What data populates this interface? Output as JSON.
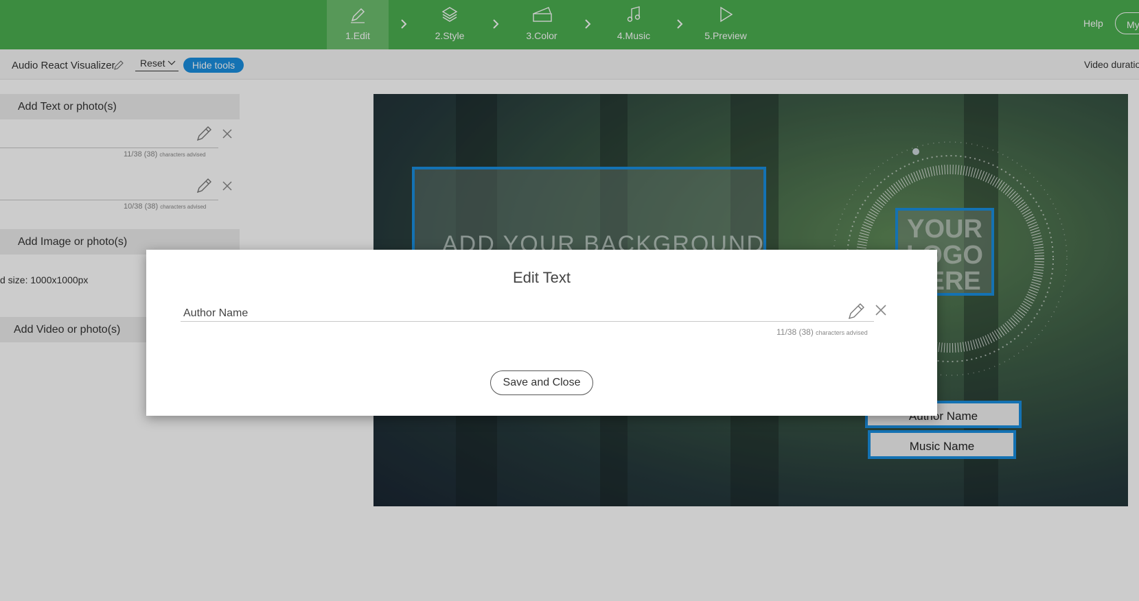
{
  "steps": [
    {
      "label": "1.Edit",
      "icon": "pencil-icon",
      "active": true
    },
    {
      "label": "2.Style",
      "icon": "layers-icon",
      "active": false
    },
    {
      "label": "3.Color",
      "icon": "swatch-icon",
      "active": false
    },
    {
      "label": "4.Music",
      "icon": "music-note-icon",
      "active": false
    },
    {
      "label": "5.Preview",
      "icon": "play-icon",
      "active": false
    }
  ],
  "header": {
    "help_label": "Help",
    "my_label": "My"
  },
  "toolbar": {
    "project_title": "Audio React Visualizer",
    "reset_label": "Reset",
    "hide_tools_label": "Hide tools",
    "duration_label": "Video duratio"
  },
  "panel": {
    "text_section": "Add Text or photo(s)",
    "text_items": [
      {
        "count": "11/38 (38)",
        "advice": "characters advised"
      },
      {
        "count": "10/38 (38)",
        "advice": "characters advised"
      }
    ],
    "image_section": "Add Image or photo(s)",
    "image_size": "d size: 1000x1000px",
    "video_section": "Add Video or photo(s)"
  },
  "preview": {
    "background_text": "ADD YOUR BACKGROUND",
    "logo_text": [
      "YOUR",
      "LOGO",
      "HERE"
    ],
    "author_name": "Author Name",
    "music_name": "Music Name"
  },
  "modal": {
    "title": "Edit Text",
    "input_value": "Author Name",
    "count": "11/38 (38)",
    "advice": "characters advised",
    "save_label": "Save and Close"
  },
  "colors": {
    "header_green": "#4caf50",
    "accent_blue": "#1a8fe0"
  }
}
